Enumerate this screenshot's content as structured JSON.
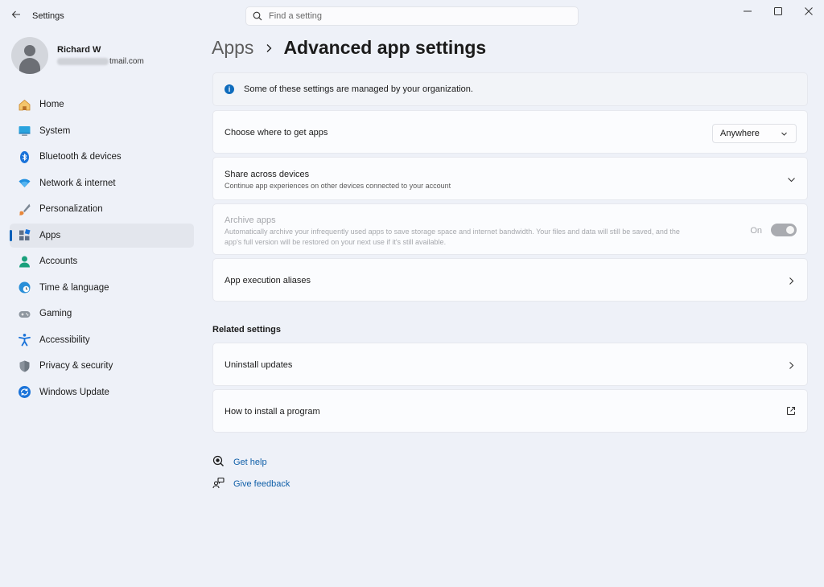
{
  "titlebar": {
    "app_title": "Settings",
    "search_placeholder": "Find a setting"
  },
  "profile": {
    "name": "Richard W",
    "email_visible": "tmail.com"
  },
  "nav": {
    "items": [
      {
        "label": "Home",
        "icon": "home-icon"
      },
      {
        "label": "System",
        "icon": "system-icon"
      },
      {
        "label": "Bluetooth & devices",
        "icon": "bluetooth-icon"
      },
      {
        "label": "Network & internet",
        "icon": "wifi-icon"
      },
      {
        "label": "Personalization",
        "icon": "brush-icon"
      },
      {
        "label": "Apps",
        "icon": "apps-icon",
        "selected": true
      },
      {
        "label": "Accounts",
        "icon": "accounts-icon"
      },
      {
        "label": "Time & language",
        "icon": "globe-clock-icon"
      },
      {
        "label": "Gaming",
        "icon": "gamepad-icon"
      },
      {
        "label": "Accessibility",
        "icon": "accessibility-icon"
      },
      {
        "label": "Privacy & security",
        "icon": "shield-icon"
      },
      {
        "label": "Windows Update",
        "icon": "update-icon"
      }
    ]
  },
  "breadcrumb": {
    "parent": "Apps",
    "current": "Advanced app settings"
  },
  "info_banner": {
    "text": "Some of these settings are managed by your organization."
  },
  "settings": {
    "get_apps": {
      "title": "Choose where to get apps",
      "value": "Anywhere"
    },
    "share": {
      "title": "Share across devices",
      "subtitle": "Continue app experiences on other devices connected to your account"
    },
    "archive": {
      "title": "Archive apps",
      "subtitle_line1": "Automatically archive your infrequently used apps to save storage space and internet bandwidth. Your files and data will still be saved, and the",
      "subtitle_line2": "app's full version will be restored on your next use if it's still available.",
      "state": "On",
      "enabled": false
    },
    "aliases": {
      "title": "App execution aliases"
    }
  },
  "related": {
    "section_title": "Related settings",
    "uninstall_updates": "Uninstall updates",
    "install_program": "How to install a program"
  },
  "help": {
    "get_help": "Get help",
    "give_feedback": "Give feedback"
  },
  "colors": {
    "accent": "#005fb8",
    "background": "#eef1f8",
    "card": "#fbfcfe"
  }
}
